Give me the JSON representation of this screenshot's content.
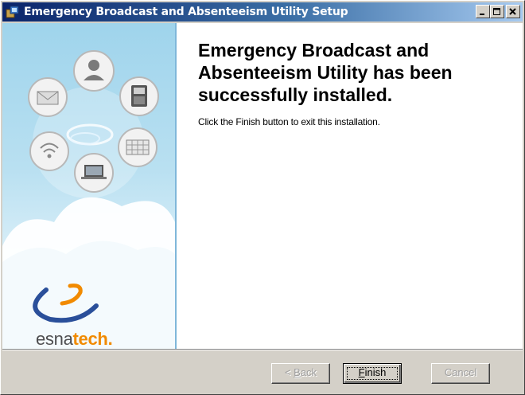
{
  "window": {
    "title": "Emergency Broadcast and Absenteeism Utility Setup"
  },
  "main": {
    "heading": "Emergency Broadcast and Absenteeism Utility has been successfully installed.",
    "description": "Click the Finish button to exit this installation."
  },
  "sidebar": {
    "brand_part1": "esna",
    "brand_part2": "tech",
    "brand_dot": "."
  },
  "buttons": {
    "back_prefix": "< ",
    "back_access": "B",
    "back_rest": "ack",
    "finish_access": "F",
    "finish_rest": "inish",
    "cancel": "Cancel"
  },
  "colors": {
    "titlebar_start": "#0a246a",
    "brand_accent": "#f18a00",
    "sidebar_blue": "#9fd4ec"
  }
}
